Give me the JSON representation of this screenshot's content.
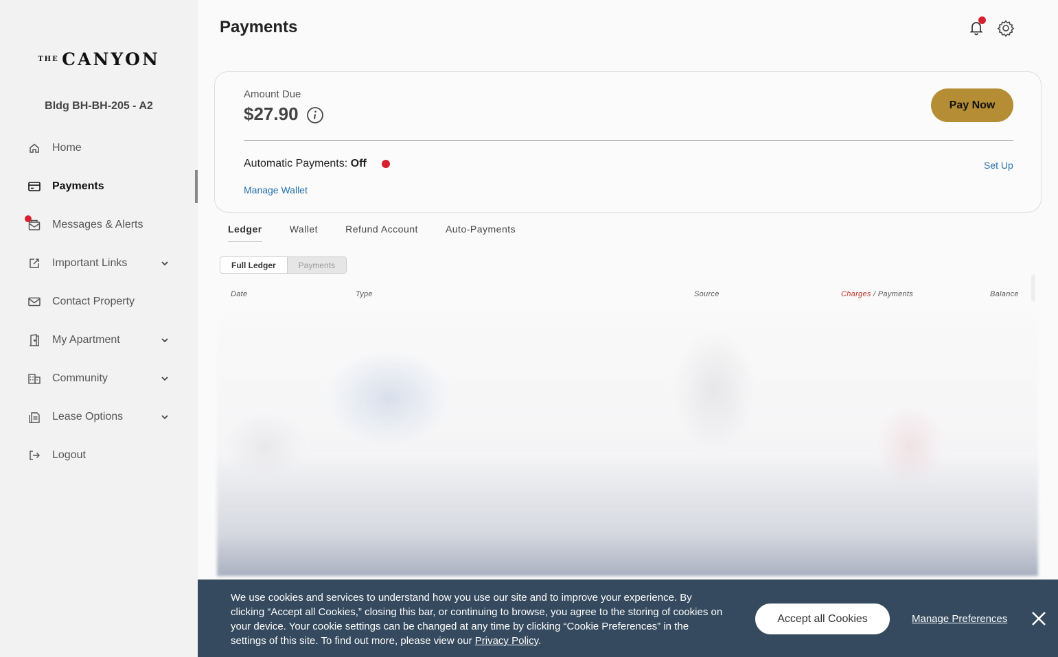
{
  "sidebar": {
    "logo_small": "THE",
    "logo_main": "CANYON",
    "building": "Bldg BH-BH-205 - A2",
    "items": [
      {
        "label": "Home",
        "icon": "home-icon"
      },
      {
        "label": "Payments",
        "icon": "credit-card-icon",
        "active": true
      },
      {
        "label": "Messages & Alerts",
        "icon": "mail-open-icon",
        "badge": true
      },
      {
        "label": "Important Links",
        "icon": "external-link-icon",
        "expandable": true
      },
      {
        "label": "Contact Property",
        "icon": "envelope-icon"
      },
      {
        "label": "My Apartment",
        "icon": "door-icon",
        "expandable": true
      },
      {
        "label": "Community",
        "icon": "building-icon",
        "expandable": true
      },
      {
        "label": "Lease Options",
        "icon": "document-icon",
        "expandable": true
      },
      {
        "label": "Logout",
        "icon": "logout-icon"
      }
    ]
  },
  "header": {
    "title": "Payments"
  },
  "amount_card": {
    "due_label": "Amount Due",
    "due_amount": "$27.90",
    "pay_button": "Pay Now",
    "auto_label": "Automatic Payments:",
    "auto_status": "Off",
    "setup_link": "Set Up",
    "wallet_link": "Manage Wallet"
  },
  "tabs": [
    {
      "label": "Ledger",
      "active": true
    },
    {
      "label": "Wallet"
    },
    {
      "label": "Refund Account"
    },
    {
      "label": "Auto-Payments"
    }
  ],
  "segmented": {
    "full": "Full Ledger",
    "payments": "Payments"
  },
  "table": {
    "headers": {
      "date": "Date",
      "type": "Type",
      "source": "Source",
      "charges": "Charges",
      "slash": " / ",
      "payments": "Payments",
      "balance": "Balance"
    }
  },
  "cookie": {
    "text": "We use cookies and services to understand how you use our site and to improve your experience. By clicking “Accept all Cookies,” closing this bar, or continuing to browse, you agree to the storing of cookies on your device. Your cookie settings can be changed at any time by clicking “Cookie Preferences” in the settings of this site. To find out more, please view our ",
    "privacy_link": "Privacy Policy",
    "end": ".",
    "accept": "Accept all Cookies",
    "manage": "Manage Preferences"
  },
  "colors": {
    "accent_gold": "#b58d35",
    "alert_red": "#d4202f",
    "link_blue": "#2670a8",
    "banner_bg": "#354a5e"
  }
}
